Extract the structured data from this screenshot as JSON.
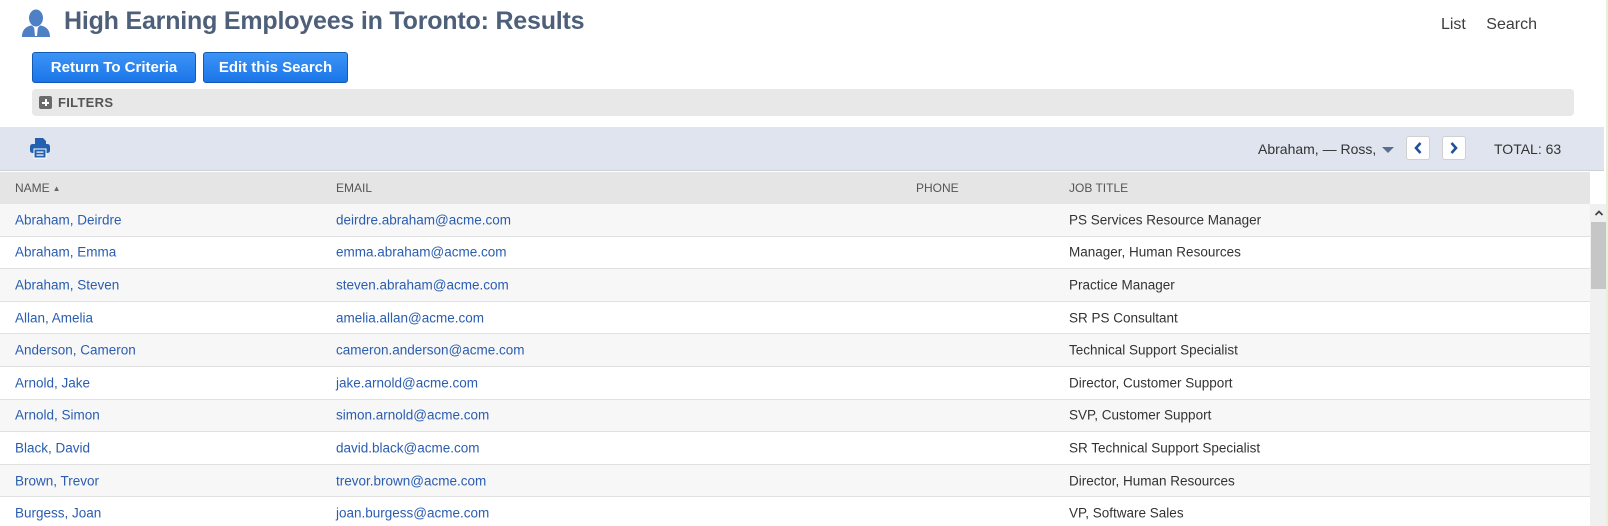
{
  "header": {
    "title": "High Earning Employees in Toronto: Results",
    "links": [
      "List",
      "Search"
    ],
    "title_color": "#4d5f79"
  },
  "actions": {
    "return_label": "Return To Criteria",
    "edit_label": "Edit this Search",
    "button_color": "#1a75e8"
  },
  "filters": {
    "label": "FILTERS",
    "expanded": false
  },
  "toolbar": {
    "range_label": "Abraham, — Ross,",
    "total_label": "TOTAL: 63",
    "icons": {
      "print": "print-icon",
      "prev": "chevron-left-icon",
      "next": "chevron-right-icon",
      "range_dropdown": "caret-down-icon"
    }
  },
  "table": {
    "columns": [
      {
        "label": "NAME",
        "sorted": "ascending",
        "sort_indicator": "▲"
      },
      {
        "label": "EMAIL"
      },
      {
        "label": "PHONE"
      },
      {
        "label": "JOB TITLE"
      }
    ],
    "rows": [
      {
        "name": "Abraham, Deirdre",
        "email": "deirdre.abraham@acme.com",
        "phone": "",
        "job_title": "PS Services Resource Manager"
      },
      {
        "name": "Abraham, Emma",
        "email": "emma.abraham@acme.com",
        "phone": "",
        "job_title": "Manager, Human Resources"
      },
      {
        "name": "Abraham, Steven",
        "email": "steven.abraham@acme.com",
        "phone": "",
        "job_title": "Practice Manager"
      },
      {
        "name": "Allan, Amelia",
        "email": "amelia.allan@acme.com",
        "phone": "",
        "job_title": "SR PS Consultant"
      },
      {
        "name": "Anderson, Cameron",
        "email": "cameron.anderson@acme.com",
        "phone": "",
        "job_title": "Technical Support Specialist"
      },
      {
        "name": "Arnold, Jake",
        "email": "jake.arnold@acme.com",
        "phone": "",
        "job_title": "Director, Customer Support"
      },
      {
        "name": "Arnold, Simon",
        "email": "simon.arnold@acme.com",
        "phone": "",
        "job_title": "SVP, Customer Support"
      },
      {
        "name": "Black, David",
        "email": "david.black@acme.com",
        "phone": "",
        "job_title": "SR Technical Support Specialist"
      },
      {
        "name": "Brown, Trevor",
        "email": "trevor.brown@acme.com",
        "phone": "",
        "job_title": "Director, Human Resources"
      },
      {
        "name": "Burgess, Joan",
        "email": "joan.burgess@acme.com",
        "phone": "",
        "job_title": "VP, Software Sales"
      }
    ]
  }
}
